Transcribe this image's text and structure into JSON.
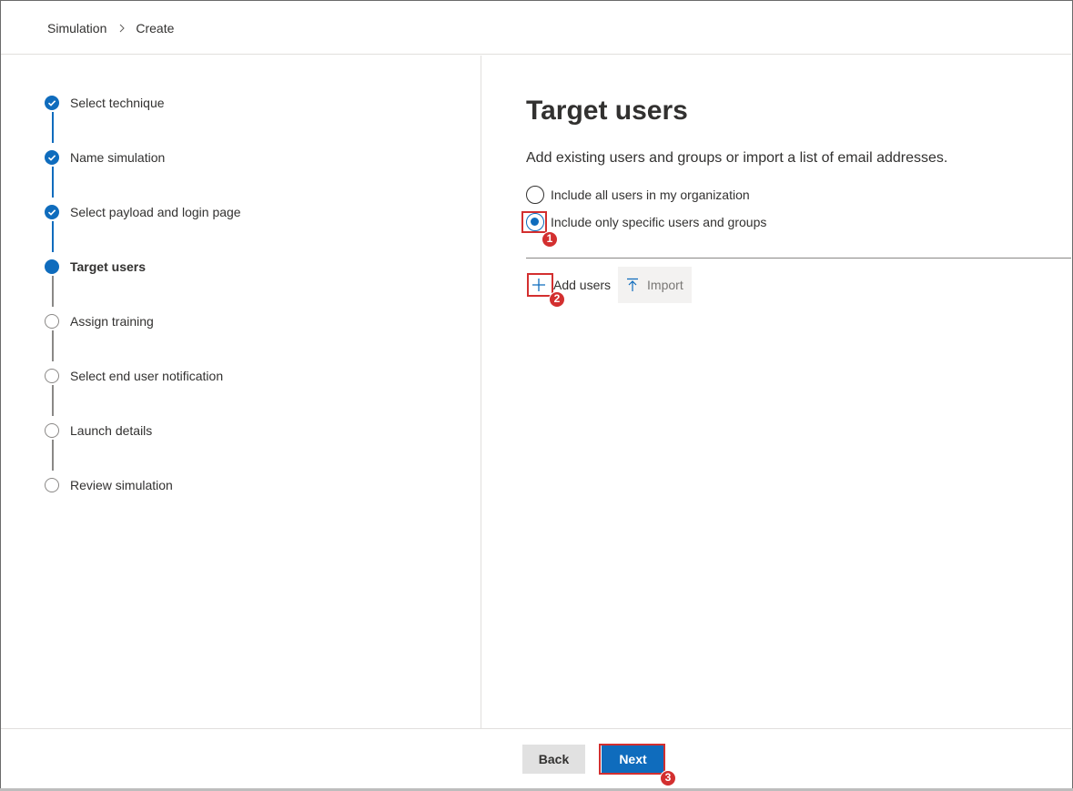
{
  "breadcrumb": {
    "items": [
      "Simulation",
      "Create"
    ]
  },
  "steps": [
    {
      "label": "Select technique",
      "state": "done"
    },
    {
      "label": "Name simulation",
      "state": "done"
    },
    {
      "label": "Select payload and login page",
      "state": "done"
    },
    {
      "label": "Target users",
      "state": "current"
    },
    {
      "label": "Assign training",
      "state": "todo"
    },
    {
      "label": "Select end user notification",
      "state": "todo"
    },
    {
      "label": "Launch details",
      "state": "todo"
    },
    {
      "label": "Review simulation",
      "state": "todo"
    }
  ],
  "main": {
    "title": "Target users",
    "description": "Add existing users and groups or import a list of email addresses.",
    "options": [
      {
        "label": "Include all users in my organization",
        "checked": false
      },
      {
        "label": "Include only specific users and groups",
        "checked": true
      }
    ],
    "toolbar": {
      "add_label": "Add users",
      "import_label": "Import"
    }
  },
  "footer": {
    "back_label": "Back",
    "next_label": "Next"
  },
  "annotations": {
    "one": "1",
    "two": "2",
    "three": "3"
  },
  "colors": {
    "accent": "#0f6cbd",
    "annotation": "#d32f2f"
  }
}
